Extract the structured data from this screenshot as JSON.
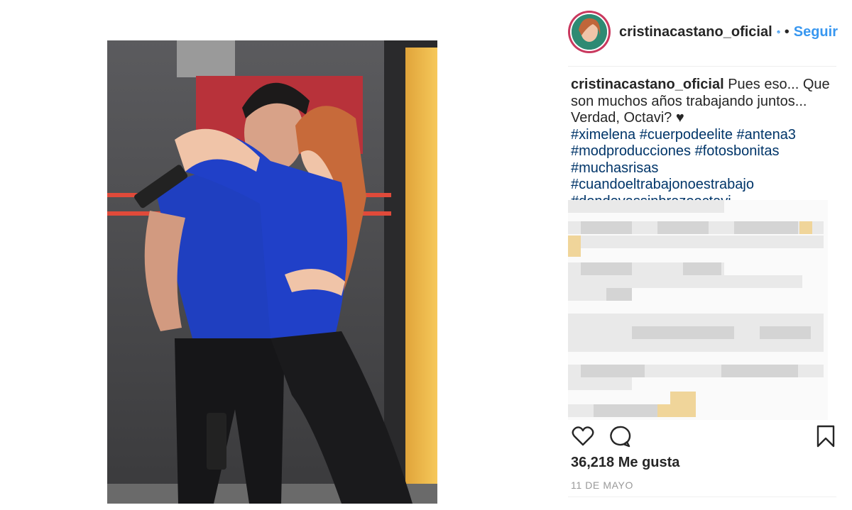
{
  "post": {
    "username": "cristinacastano_oficial",
    "follow_label": "Seguir",
    "separator": "•",
    "caption_user": "cristinacastano_oficial",
    "caption_text": "Pues eso... Que son muchos años trabajando juntos... Verdad, Octavi? ♥",
    "hashtags": [
      "#ximelena",
      "#cuerpodeelite",
      "#antena3",
      "#modproducciones",
      "#fotosbonitas",
      "#muchasrisas",
      "#cuandoeltrabajonoestrabajo",
      "#dondevassinbrazooctavi"
    ],
    "likes": "36,218 Me gusta",
    "date": "11 DE MAYO"
  },
  "icons": {
    "verified": "verified-badge-icon",
    "like": "heart-icon",
    "comment": "comment-bubble-icon",
    "save": "bookmark-icon"
  },
  "colors": {
    "link": "#3897f0",
    "hashtag": "#003569",
    "text": "#262626",
    "muted": "#999999",
    "avatar_ring": "#c9385e"
  }
}
